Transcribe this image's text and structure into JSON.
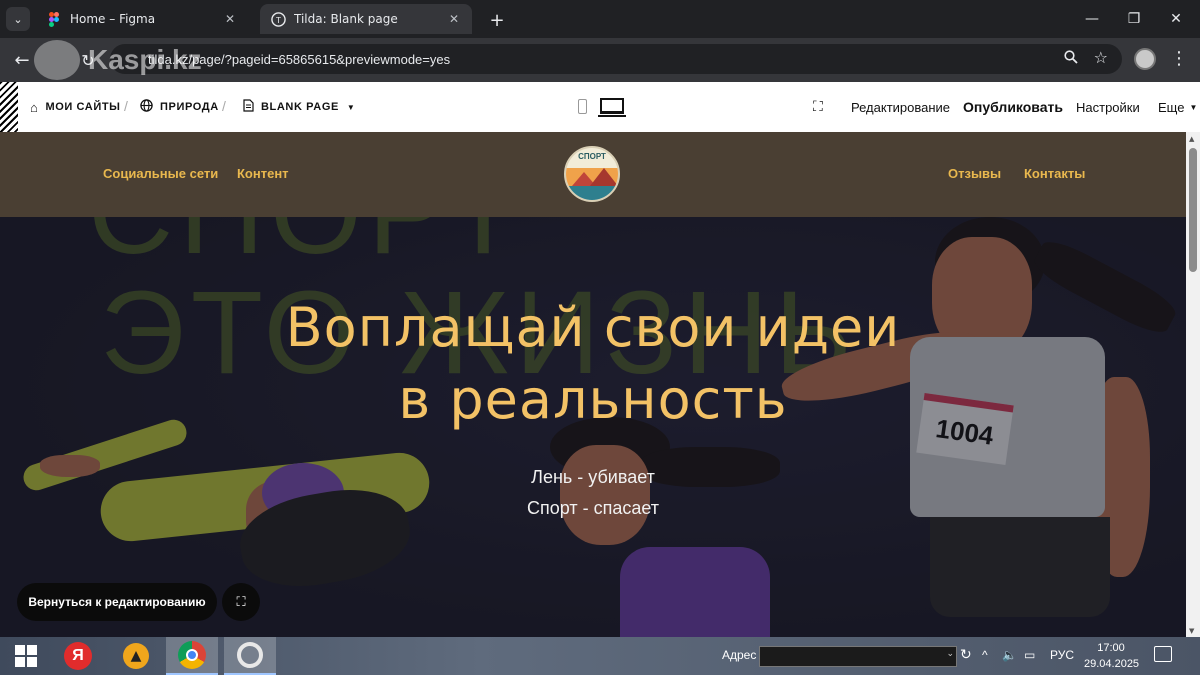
{
  "browser": {
    "tabs": [
      {
        "title": "Home – Figma",
        "icon": "figma-icon"
      },
      {
        "title": "Tilda: Blank page",
        "icon": "tilda-icon"
      }
    ],
    "url": "tilda.kz/page/?pageid=65865615&previewmode=yes",
    "watermark": "Kaspi.kz"
  },
  "tilda_bar": {
    "breadcrumbs": [
      "МОИ САЙТЫ",
      "ПРИРОДА",
      "BLANK PAGE"
    ],
    "edit": "Редактирование",
    "publish": "Опубликовать",
    "settings": "Настройки",
    "more": "Еще"
  },
  "site": {
    "nav_left": [
      "Социальные сети",
      "Контент"
    ],
    "nav_right": [
      "Отзывы",
      "Контакты"
    ],
    "logo_text": "СПОРТ",
    "bg_text": [
      "СПОРТ",
      "ЭТО ЖИЗНЬ"
    ],
    "bib_number": "1004",
    "hero_title_line1": "Воплащай свои идеи",
    "hero_title_line2": "в реальность",
    "hero_sub_line1": "Лень - убивает",
    "hero_sub_line2": "Спорт - спасает",
    "back_to_edit": "Вернуться к редактированию"
  },
  "taskbar": {
    "address_label": "Адрес",
    "language": "РУС",
    "time": "17:00",
    "date": "29.04.2025"
  },
  "colors": {
    "header_bg": "#4a3f33",
    "nav_accent": "#e9b84e",
    "hero_title": "#f3c266"
  }
}
